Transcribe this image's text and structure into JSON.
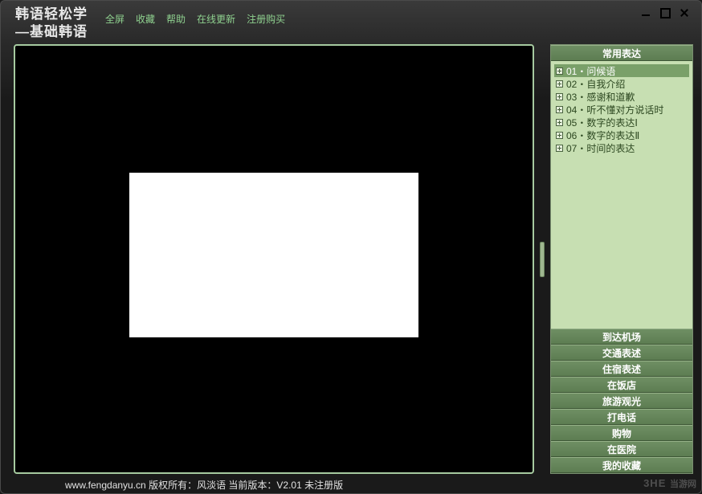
{
  "app": {
    "title_line1": "韩语轻松学",
    "title_line2": "—基础韩语"
  },
  "menu": {
    "items": [
      {
        "label": "全屏"
      },
      {
        "label": "收藏"
      },
      {
        "label": "帮助"
      },
      {
        "label": "在线更新"
      },
      {
        "label": "注册购买"
      }
    ]
  },
  "window_controls": {
    "minimize": "minimize",
    "maximize": "maximize",
    "close": "close"
  },
  "sidebar": {
    "expanded_header": "常用表达",
    "lessons": [
      {
        "label": "01・问候语",
        "selected": true
      },
      {
        "label": "02・自我介绍",
        "selected": false
      },
      {
        "label": "03・感谢和道歉",
        "selected": false
      },
      {
        "label": "04・听不懂对方说话时",
        "selected": false
      },
      {
        "label": "05・数字的表达Ⅰ",
        "selected": false
      },
      {
        "label": "06・数字的表达Ⅱ",
        "selected": false
      },
      {
        "label": "07・时间的表达",
        "selected": false
      }
    ],
    "categories": [
      {
        "label": "到达机场"
      },
      {
        "label": "交通表述"
      },
      {
        "label": "住宿表述"
      },
      {
        "label": "在饭店"
      },
      {
        "label": "旅游观光"
      },
      {
        "label": "打电话"
      },
      {
        "label": "购物"
      },
      {
        "label": "在医院"
      },
      {
        "label": "我的收藏"
      }
    ]
  },
  "statusbar": {
    "text": "www.fengdanyu.cn 版权所有：风淡语  当前版本：V2.01 未注册版"
  },
  "watermark": {
    "brand": "3HE",
    "sub": "当游网"
  }
}
